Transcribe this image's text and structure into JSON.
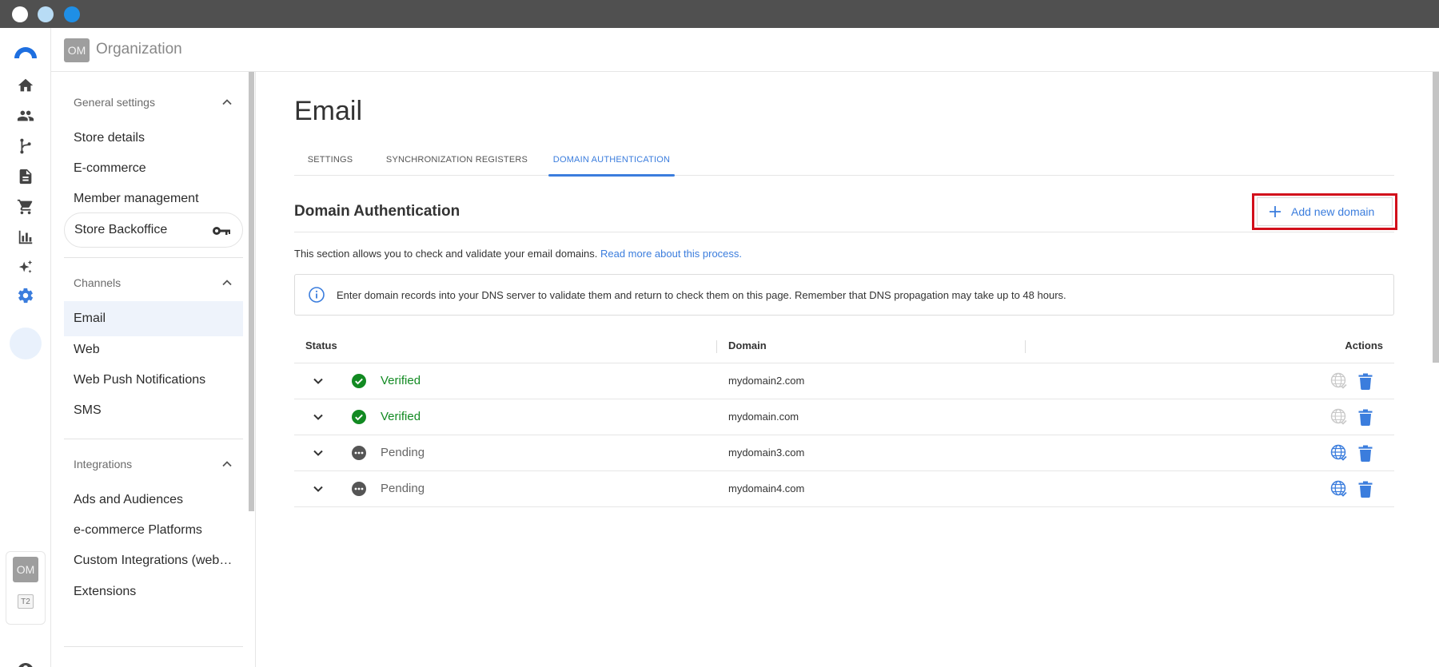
{
  "window": {
    "controls": [
      "close",
      "minimize",
      "maximize"
    ]
  },
  "header": {
    "org_avatar": "OM",
    "org_name": "Organization"
  },
  "rail": {
    "icons": [
      "logo-icon",
      "home-icon",
      "people-icon",
      "flow-icon",
      "document-icon",
      "cart-icon",
      "chart-icon",
      "sparkle-icon",
      "gear-icon"
    ],
    "avatar": "OM",
    "badge": "T2",
    "active_color": "#3b7ddd"
  },
  "sidebar": {
    "sections": [
      {
        "label": "General settings",
        "items": [
          "Store details",
          "E-commerce",
          "Member management",
          "Store Backoffice"
        ]
      },
      {
        "label": "Channels",
        "items": [
          "Email",
          "Web",
          "Web Push Notifications",
          "SMS"
        ]
      },
      {
        "label": "Integrations",
        "items": [
          "Ads and Audiences",
          "e-commerce Platforms",
          "Custom Integrations (webh…",
          "Extensions"
        ]
      }
    ],
    "active_item": "Email"
  },
  "main": {
    "title": "Email",
    "tabs": [
      {
        "label": "SETTINGS"
      },
      {
        "label": "SYNCHRONIZATION REGISTERS"
      },
      {
        "label": "DOMAIN AUTHENTICATION"
      }
    ],
    "active_tab": "DOMAIN AUTHENTICATION",
    "section_title": "Domain Authentication",
    "add_button": "Add new domain",
    "description": "This section allows you to check and validate your email domains.",
    "read_more": "Read more about this process.",
    "info": "Enter domain records into your DNS server to validate them and return to check them on this page. Remember that DNS propagation may take up to 48 hours.",
    "table": {
      "headers": {
        "status": "Status",
        "domain": "Domain",
        "actions": "Actions"
      },
      "rows": [
        {
          "status": "Verified",
          "domain": "mydomain2.com"
        },
        {
          "status": "Verified",
          "domain": "mydomain.com"
        },
        {
          "status": "Pending",
          "domain": "mydomain3.com"
        },
        {
          "status": "Pending",
          "domain": "mydomain4.com"
        }
      ]
    }
  },
  "colors": {
    "accent": "#3b7ddd",
    "verified": "#128a22",
    "highlight": "#d20f1b"
  }
}
